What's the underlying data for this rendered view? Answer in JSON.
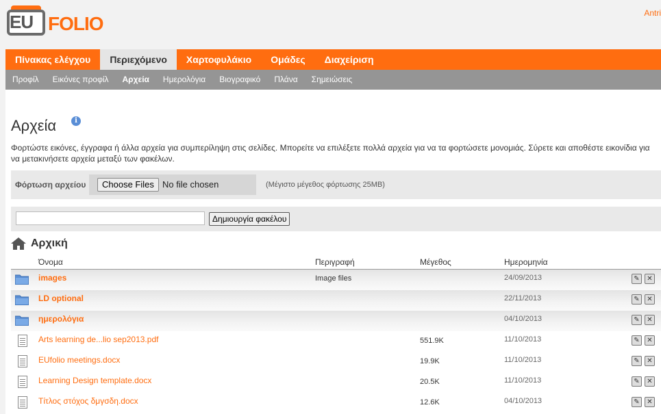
{
  "header": {
    "logo_text_eu": "EU",
    "logo_text_folio": "FOLIO",
    "user_link": "Antri"
  },
  "main_nav": {
    "items": [
      "Πίνακας ελέγχου",
      "Περιεχόμενο",
      "Χαρτοφυλάκιο",
      "Ομάδες",
      "Διαχείριση"
    ],
    "active": "Περιεχόμενο"
  },
  "sub_nav": {
    "items": [
      "Προφίλ",
      "Εικόνες προφίλ",
      "Αρχεία",
      "Ημερολόγια",
      "Βιογραφικό",
      "Πλάνα",
      "Σημειώσεις"
    ],
    "active": "Αρχεία"
  },
  "page": {
    "title": "Αρχεία",
    "description": "Φορτώστε εικόνες, έγγραφα ή άλλα αρχεία για συμπερίληψη στις σελίδες. Μπορείτε να επιλέξετε πολλά αρχεία για να τα φορτώσετε μονομιάς. Σύρετε και αποθέστε εικονίδια για να μετακινήσετε αρχεία μεταξύ των φακέλων."
  },
  "upload": {
    "label": "Φόρτωση αρχείου",
    "choose_button": "Choose Files",
    "no_file": "No file chosen",
    "max_size": "(Μέγιστο μέγεθος φόρτωσης 25MB)"
  },
  "create_folder": {
    "input_value": "",
    "button": "Δημιουργία φακέλου"
  },
  "breadcrumb": {
    "home": "Αρχική"
  },
  "table": {
    "headers": {
      "name": "Όνομα",
      "description": "Περιγραφή",
      "size": "Μέγεθος",
      "date": "Ημερομηνία"
    },
    "rows": [
      {
        "type": "folder",
        "name": "images",
        "description": "Image files",
        "size": "",
        "date": "24/09/2013"
      },
      {
        "type": "folder",
        "name": "LD optional",
        "description": "",
        "size": "",
        "date": "22/11/2013"
      },
      {
        "type": "folder",
        "name": "ημερολόγια",
        "description": "",
        "size": "",
        "date": "04/10/2013"
      },
      {
        "type": "file",
        "name": "Arts learning de...lio sep2013.pdf",
        "description": "",
        "size": "551.9K",
        "date": "11/10/2013"
      },
      {
        "type": "file",
        "name": "EUfolio meetings.docx",
        "description": "",
        "size": "19.9K",
        "date": "11/10/2013"
      },
      {
        "type": "file",
        "name": "Learning Design template.docx",
        "description": "",
        "size": "20.5K",
        "date": "11/10/2013"
      },
      {
        "type": "file",
        "name": "Τίτλος στόχος δμγσδη.docx",
        "description": "",
        "size": "12.6K",
        "date": "04/10/2013"
      }
    ]
  },
  "colors": {
    "accent": "#ff6d10",
    "subnav": "#959595",
    "folder_icon": "#5b8fd4"
  }
}
